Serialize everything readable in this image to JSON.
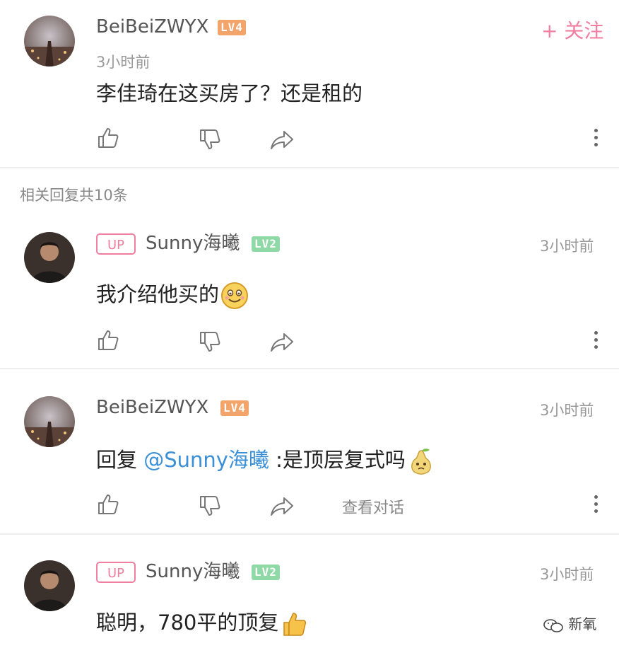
{
  "main_comment": {
    "username": "BeiBeiZWYX",
    "level": "LV4",
    "time": "3小时前",
    "text": "李佳琦在这买房了？还是租的",
    "follow_label": "+ 关注"
  },
  "replies_header": "相关回复共10条",
  "replies": [
    {
      "badge": "UP",
      "username": "Sunny海曦",
      "level": "LV2",
      "time": "3小时前",
      "text": "我介绍他买的"
    },
    {
      "username": "BeiBeiZWYX",
      "level": "LV4",
      "time": "3小时前",
      "prefix": "回复 ",
      "mention": "@Sunny海曦",
      "text": " :是顶层复式吗",
      "view_conversation": "查看对话"
    },
    {
      "badge": "UP",
      "username": "Sunny海曦",
      "level": "LV2",
      "time": "3小时前",
      "text": "聪明，780平的顶复"
    }
  ],
  "watermark": "新氧",
  "colors": {
    "accent_pink": "#f07ea0",
    "mention_blue": "#3a8fd6",
    "lv4_orange": "#f3a46a",
    "lv2_green": "#8fd9a6"
  }
}
